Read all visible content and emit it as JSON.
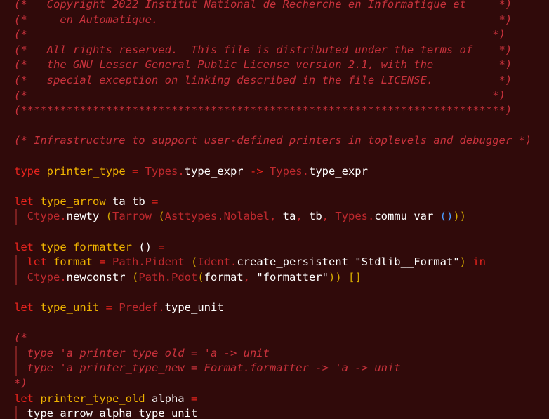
{
  "editor": {
    "colors": {
      "background": "#300a0a",
      "comment": "#c8323c",
      "keyword": "#e8241e",
      "identifier": "#f0b400",
      "module": "#c0292e",
      "plain": "#ffffff",
      "paren": "#d4a800",
      "paren_inner": "#4a9cff",
      "indent_guide": "#7a2020"
    },
    "lines": [
      {
        "guide": false,
        "segments": [
          {
            "t": "(*   Copyright 2022 Institut National de Recherche en Informatique et     *)",
            "c": "comment"
          }
        ]
      },
      {
        "guide": false,
        "segments": [
          {
            "t": "(*     en Automatique.                                                    *)",
            "c": "comment"
          }
        ]
      },
      {
        "guide": false,
        "segments": [
          {
            "t": "(*                                                                       *)",
            "c": "comment"
          }
        ]
      },
      {
        "guide": false,
        "segments": [
          {
            "t": "(*   All rights reserved.  This file is distributed under the terms of    *)",
            "c": "comment"
          }
        ]
      },
      {
        "guide": false,
        "segments": [
          {
            "t": "(*   the GNU Lesser General Public License version 2.1, with the          *)",
            "c": "comment"
          }
        ]
      },
      {
        "guide": false,
        "segments": [
          {
            "t": "(*   special exception on linking described in the file LICENSE.          *)",
            "c": "comment"
          }
        ]
      },
      {
        "guide": false,
        "segments": [
          {
            "t": "(*                                                                       *)",
            "c": "comment"
          }
        ]
      },
      {
        "guide": false,
        "segments": [
          {
            "t": "(**************************************************************************)",
            "c": "comment"
          }
        ]
      },
      {
        "guide": false,
        "segments": []
      },
      {
        "guide": false,
        "segments": [
          {
            "t": "(* Infrastructure to support user-defined printers in toplevels and debugger *)",
            "c": "comment"
          }
        ]
      },
      {
        "guide": false,
        "segments": []
      },
      {
        "guide": false,
        "segments": [
          {
            "t": "type ",
            "c": "kw"
          },
          {
            "t": "printer_type",
            "c": "ident"
          },
          {
            "t": " = ",
            "c": "op"
          },
          {
            "t": "Types.",
            "c": "module"
          },
          {
            "t": "type_expr",
            "c": "plain"
          },
          {
            "t": " -> ",
            "c": "op"
          },
          {
            "t": "Types.",
            "c": "module"
          },
          {
            "t": "type_expr",
            "c": "plain"
          }
        ]
      },
      {
        "guide": false,
        "segments": []
      },
      {
        "guide": false,
        "segments": [
          {
            "t": "let ",
            "c": "kw"
          },
          {
            "t": "type_arrow",
            "c": "ident"
          },
          {
            "t": " ta tb",
            "c": "plain"
          },
          {
            "t": " =",
            "c": "op"
          }
        ]
      },
      {
        "guide": true,
        "segments": [
          {
            "t": "  Ctype.",
            "c": "module"
          },
          {
            "t": "newty",
            "c": "plain"
          },
          {
            "t": " (",
            "c": "paren"
          },
          {
            "t": "Tarrow",
            "c": "module"
          },
          {
            "t": " (",
            "c": "paren"
          },
          {
            "t": "Asttypes.Nolabel",
            "c": "module"
          },
          {
            "t": ", ",
            "c": "punct"
          },
          {
            "t": "ta",
            "c": "plain"
          },
          {
            "t": ", ",
            "c": "punct"
          },
          {
            "t": "tb",
            "c": "plain"
          },
          {
            "t": ", ",
            "c": "punct"
          },
          {
            "t": "Types.",
            "c": "module"
          },
          {
            "t": "commu_var",
            "c": "plain"
          },
          {
            "t": " ()",
            "c": "paren2"
          },
          {
            "t": "))",
            "c": "paren"
          }
        ]
      },
      {
        "guide": false,
        "segments": []
      },
      {
        "guide": false,
        "segments": [
          {
            "t": "let ",
            "c": "kw"
          },
          {
            "t": "type_formatter",
            "c": "ident"
          },
          {
            "t": " ()",
            "c": "plain"
          },
          {
            "t": " =",
            "c": "op"
          }
        ]
      },
      {
        "guide": true,
        "segments": [
          {
            "t": "  let ",
            "c": "kw"
          },
          {
            "t": "format",
            "c": "ident"
          },
          {
            "t": " = ",
            "c": "op"
          },
          {
            "t": "Path.Pident",
            "c": "module"
          },
          {
            "t": " (",
            "c": "paren"
          },
          {
            "t": "Ident.",
            "c": "module"
          },
          {
            "t": "create_persistent",
            "c": "plain"
          },
          {
            "t": " \"Stdlib__Format\"",
            "c": "string"
          },
          {
            "t": ")",
            "c": "paren"
          },
          {
            "t": " in",
            "c": "kw"
          }
        ]
      },
      {
        "guide": true,
        "segments": [
          {
            "t": "  Ctype.",
            "c": "module"
          },
          {
            "t": "newconstr",
            "c": "plain"
          },
          {
            "t": " (",
            "c": "paren"
          },
          {
            "t": "Path.Pdot",
            "c": "module"
          },
          {
            "t": "(",
            "c": "paren"
          },
          {
            "t": "format",
            "c": "plain"
          },
          {
            "t": ", ",
            "c": "punct"
          },
          {
            "t": "\"formatter\"",
            "c": "string"
          },
          {
            "t": ")) ",
            "c": "paren"
          },
          {
            "t": "[]",
            "c": "bracket"
          }
        ]
      },
      {
        "guide": false,
        "segments": []
      },
      {
        "guide": false,
        "segments": [
          {
            "t": "let ",
            "c": "kw"
          },
          {
            "t": "type_unit",
            "c": "ident"
          },
          {
            "t": " = ",
            "c": "op"
          },
          {
            "t": "Predef.",
            "c": "module"
          },
          {
            "t": "type_unit",
            "c": "plain"
          }
        ]
      },
      {
        "guide": false,
        "segments": []
      },
      {
        "guide": false,
        "segments": [
          {
            "t": "(*",
            "c": "comment"
          }
        ]
      },
      {
        "guide": true,
        "segments": [
          {
            "t": "  type 'a printer_type_old = 'a -> unit",
            "c": "comment"
          }
        ]
      },
      {
        "guide": true,
        "segments": [
          {
            "t": "  type 'a printer_type_new = Format.formatter -> 'a -> unit",
            "c": "comment"
          }
        ]
      },
      {
        "guide": false,
        "segments": [
          {
            "t": "*)",
            "c": "comment"
          }
        ]
      },
      {
        "guide": false,
        "segments": [
          {
            "t": "let ",
            "c": "kw"
          },
          {
            "t": "printer_type_old",
            "c": "ident"
          },
          {
            "t": " alpha",
            "c": "plain"
          },
          {
            "t": " =",
            "c": "op"
          }
        ]
      },
      {
        "guide": true,
        "segments": [
          {
            "t": "  type_arrow alpha ",
            "c": "plain"
          },
          {
            "t": "type_unit",
            "c": "plain"
          }
        ]
      }
    ]
  }
}
